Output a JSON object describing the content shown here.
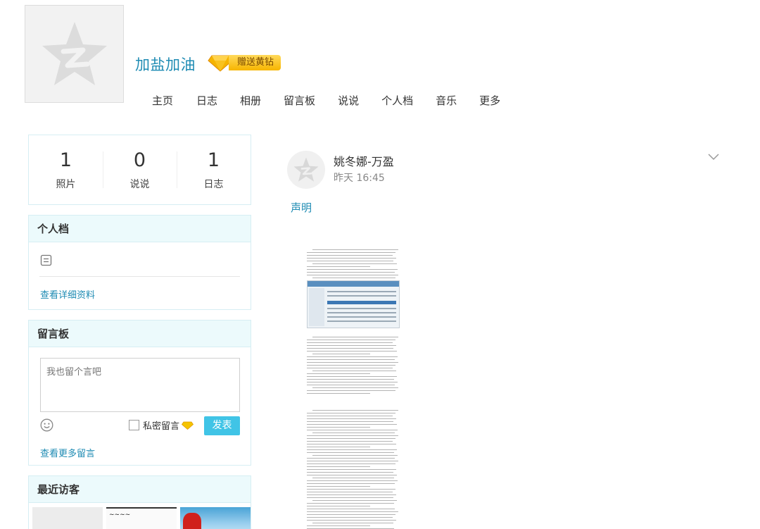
{
  "header": {
    "profile_name": "加盐加油",
    "gift_label": "赠送黄钻",
    "nav": [
      {
        "label": "主页"
      },
      {
        "label": "日志"
      },
      {
        "label": "相册"
      },
      {
        "label": "留言板"
      },
      {
        "label": "说说"
      },
      {
        "label": "个人档"
      },
      {
        "label": "音乐"
      },
      {
        "label": "更多"
      }
    ]
  },
  "stats": [
    {
      "value": "1",
      "label": "照片"
    },
    {
      "value": "0",
      "label": "说说"
    },
    {
      "value": "1",
      "label": "日志"
    }
  ],
  "profile_panel": {
    "title": "个人档",
    "link": "查看详细资料"
  },
  "guestbook": {
    "title": "留言板",
    "placeholder": "我也留个言吧",
    "private_label": "私密留言",
    "post_button": "发表",
    "more_link": "查看更多留言"
  },
  "visitors": {
    "title": "最近访客"
  },
  "post": {
    "author": "姚冬娜-万盈",
    "time": "昨天 16:45",
    "title": "声明"
  },
  "colors": {
    "link": "#1e8bb3",
    "panel_header_bg": "#ecfafc",
    "panel_border": "#d6eef3",
    "post_button_bg": "#40c4e6",
    "gift_gold": "#f7b500"
  },
  "icons": {
    "avatar": "qzone-star-icon",
    "gift": "yellow-diamond-icon",
    "profile": "document-icon",
    "emoji": "smiley-icon",
    "menu": "chevron-down-icon"
  }
}
